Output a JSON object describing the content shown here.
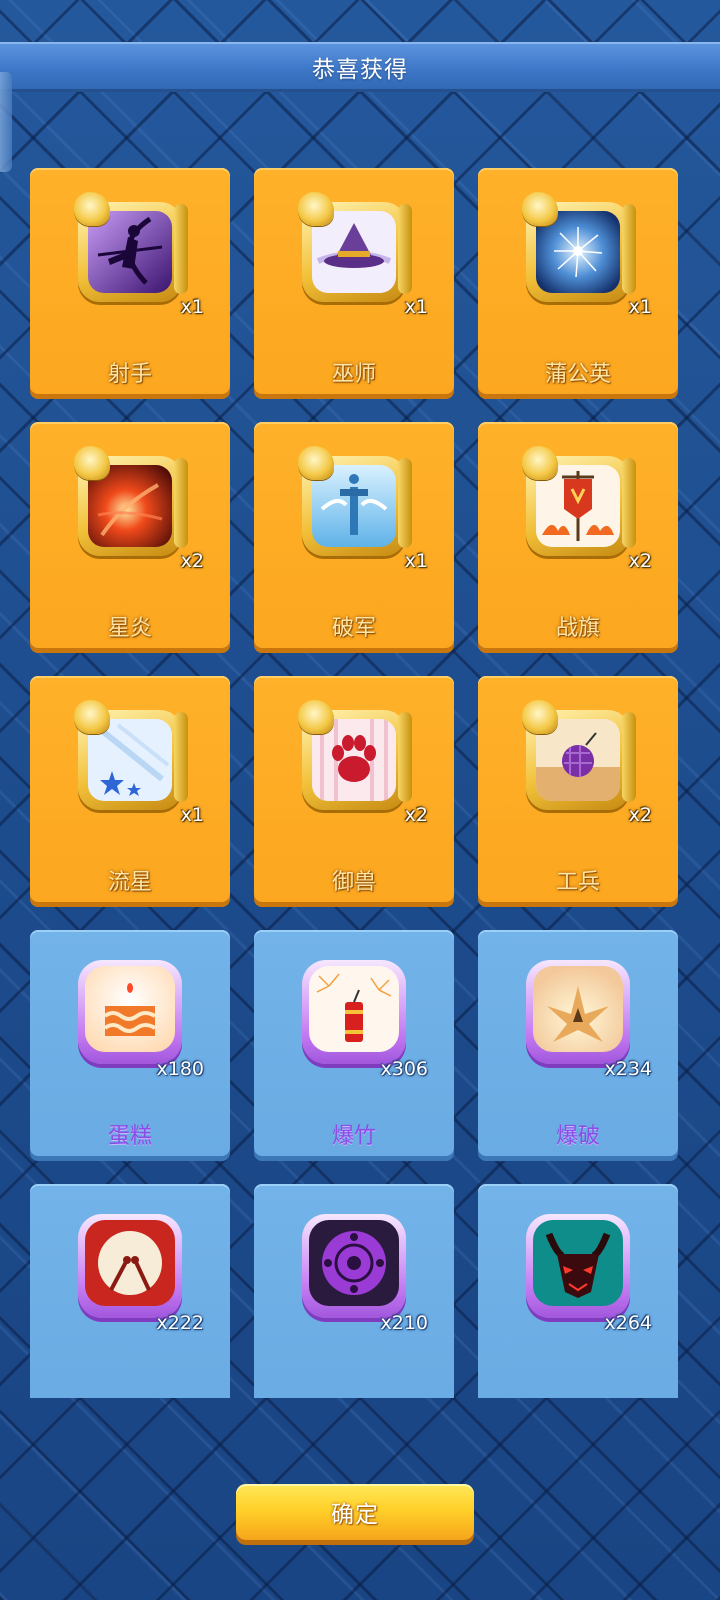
{
  "header": {
    "title": "恭喜获得"
  },
  "rewards": [
    {
      "name": "射手",
      "count": "x1",
      "rarity": "gold",
      "icon": "archer-icon"
    },
    {
      "name": "巫师",
      "count": "x1",
      "rarity": "gold",
      "icon": "wizard-hat-icon"
    },
    {
      "name": "蒲公英",
      "count": "x1",
      "rarity": "gold",
      "icon": "dandelion-icon"
    },
    {
      "name": "星炎",
      "count": "x2",
      "rarity": "gold",
      "icon": "star-flame-icon"
    },
    {
      "name": "破军",
      "count": "x1",
      "rarity": "gold",
      "icon": "sword-icon"
    },
    {
      "name": "战旗",
      "count": "x2",
      "rarity": "gold",
      "icon": "war-banner-icon"
    },
    {
      "name": "流星",
      "count": "x1",
      "rarity": "gold",
      "icon": "meteor-stars-icon"
    },
    {
      "name": "御兽",
      "count": "x2",
      "rarity": "gold",
      "icon": "paw-icon"
    },
    {
      "name": "工兵",
      "count": "x2",
      "rarity": "gold",
      "icon": "grenade-icon"
    },
    {
      "name": "蛋糕",
      "count": "x180",
      "rarity": "blue",
      "icon": "cake-icon"
    },
    {
      "name": "爆竹",
      "count": "x306",
      "rarity": "blue",
      "icon": "firecracker-icon"
    },
    {
      "name": "爆破",
      "count": "x234",
      "rarity": "blue",
      "icon": "explosion-icon"
    },
    {
      "name": "",
      "count": "x222",
      "rarity": "blue",
      "icon": "war-drum-icon"
    },
    {
      "name": "",
      "count": "x210",
      "rarity": "blue",
      "icon": "eye-sigil-icon"
    },
    {
      "name": "",
      "count": "x264",
      "rarity": "blue",
      "icon": "demon-mask-icon"
    }
  ],
  "footer": {
    "confirm_label": "确定"
  },
  "colors": {
    "gold_card": "#fca71f",
    "blue_card": "#6aabe3",
    "background": "#1f4d8e",
    "title_bar": "#4a82d0",
    "item_name_blue": "#8a4ee6"
  }
}
